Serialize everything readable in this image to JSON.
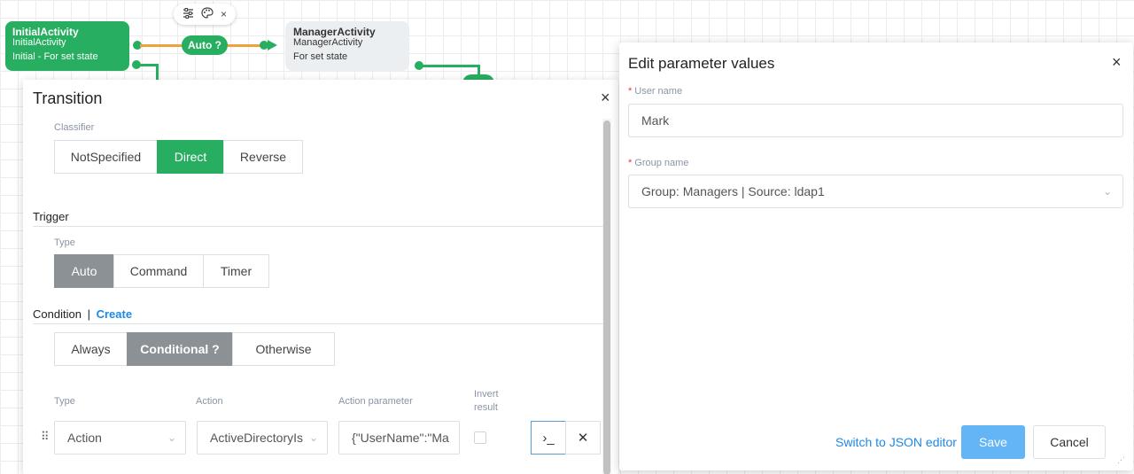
{
  "canvas": {
    "initial_node": {
      "title": "InitialActivity",
      "subtitle": "InitialActivity",
      "state": "Initial - For set state"
    },
    "manager_node": {
      "title": "ManagerActivity",
      "subtitle": "ManagerActivity",
      "state": "For set state"
    },
    "transition_pill": "Auto ?",
    "toolbar": {
      "settings_icon": "sliders-icon",
      "palette_icon": "palette-icon",
      "close_glyph": "×"
    },
    "colors": {
      "green": "#27ae60",
      "orange": "#f0a13c"
    }
  },
  "transition": {
    "title": "Transition",
    "close_glyph": "×",
    "classifier": {
      "label": "Classifier",
      "options": [
        "NotSpecified",
        "Direct",
        "Reverse"
      ],
      "selected": "Direct"
    },
    "trigger": {
      "section": "Trigger",
      "type_label": "Type",
      "options": [
        "Auto",
        "Command",
        "Timer"
      ],
      "selected": "Auto"
    },
    "condition": {
      "section": "Condition",
      "separator": "|",
      "create_link": "Create",
      "options": [
        "Always",
        "Conditional ?",
        "Otherwise"
      ],
      "selected": "Conditional ?",
      "columns": {
        "type": "Type",
        "action": "Action",
        "action_parameter": "Action parameter",
        "invert_line1": "Invert",
        "invert_line2": "result"
      },
      "row": {
        "drag_glyph": "⠿",
        "type_value": "Action",
        "action_value": "ActiveDirectoryIs",
        "parameter_value": "{\"UserName\":\"Ma",
        "invert_checked": false,
        "terminal_glyph": "›_",
        "delete_glyph": "✕"
      }
    }
  },
  "param_dialog": {
    "title": "Edit parameter values",
    "close_glyph": "×",
    "fields": {
      "user_name": {
        "label": "User name",
        "required_mark": "*",
        "value": "Mark"
      },
      "group_name": {
        "label": "Group name",
        "required_mark": "*",
        "value": "Group: Managers | Source: ldap1"
      }
    },
    "json_link": "Switch to JSON editor",
    "save_label": "Save",
    "cancel_label": "Cancel",
    "colors": {
      "save": "#64b5f6",
      "link": "#1e88e5",
      "required": "#e53935"
    }
  }
}
